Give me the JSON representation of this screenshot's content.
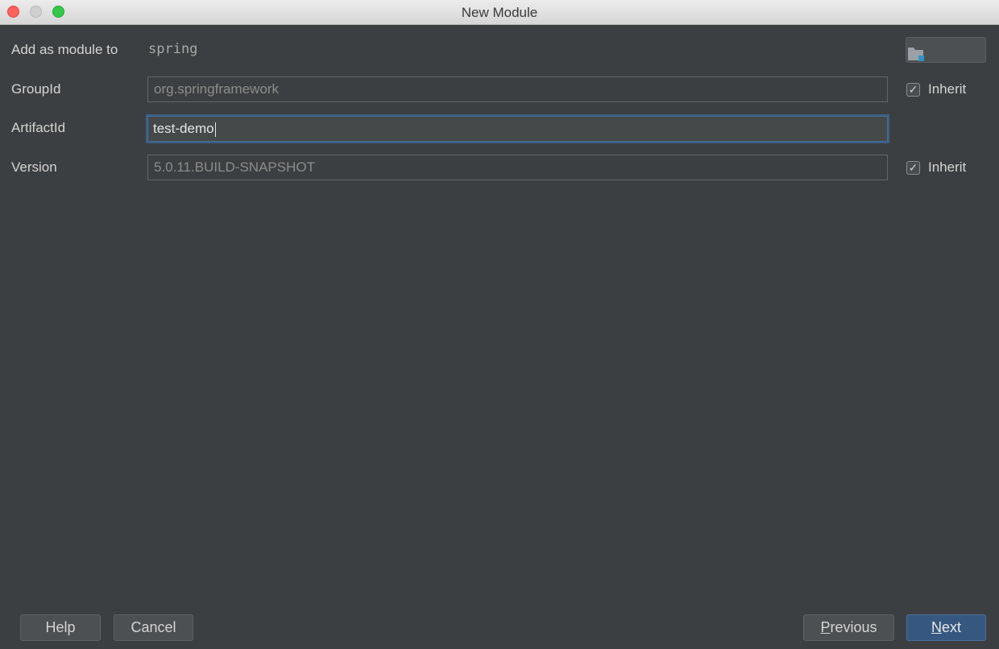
{
  "window": {
    "title": "New Module"
  },
  "form": {
    "module_parent": {
      "label": "Add as module to",
      "value": "spring"
    },
    "group_id": {
      "label": "GroupId",
      "value": "org.springframework",
      "inherit_checked": true,
      "inherit_label": "Inherit"
    },
    "artifact_id": {
      "label": "ArtifactId",
      "value": "test-demo"
    },
    "version": {
      "label": "Version",
      "value": "5.0.11.BUILD-SNAPSHOT",
      "inherit_checked": true,
      "inherit_label": "Inherit"
    }
  },
  "buttons": {
    "help": "Help",
    "cancel": "Cancel",
    "previous_first": "P",
    "previous_rest": "revious",
    "next_first": "N",
    "next_rest": "ext"
  },
  "icons": {
    "browse": "folder-icon",
    "checkmark": "✓"
  },
  "colors": {
    "background": "#3c3f41",
    "accent": "#365880",
    "focus_border": "#3d6185"
  }
}
